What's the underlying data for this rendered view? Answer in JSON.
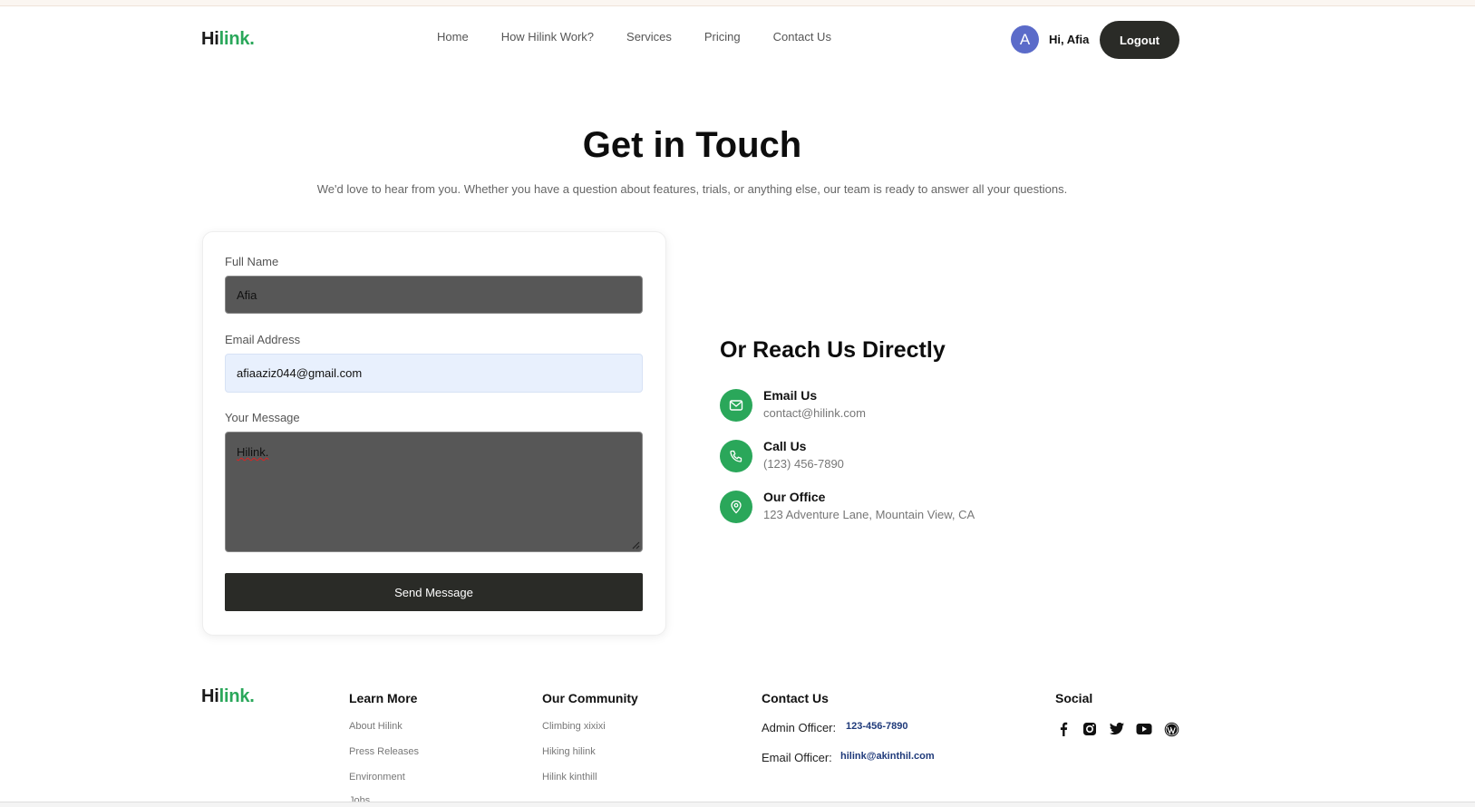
{
  "header": {
    "logo_dark": "Hi",
    "logo_green": "link.",
    "nav": [
      "Home",
      "How Hilink Work?",
      "Services",
      "Pricing",
      "Contact Us"
    ],
    "avatar_letter": "A",
    "greeting": "Hi, Afia",
    "logout_label": "Logout"
  },
  "hero": {
    "title": "Get in Touch",
    "subtitle": "We'd love to hear from you. Whether you have a question about features, trials, or anything else, our team is ready to answer all your questions."
  },
  "form": {
    "name_label": "Full Name",
    "name_value": "Afia",
    "email_label": "Email Address",
    "email_value": "afiaaziz044@gmail.com",
    "message_label": "Your Message",
    "message_value": "Hilink.",
    "submit_label": "Send Message"
  },
  "direct": {
    "heading": "Or Reach Us Directly",
    "items": [
      {
        "title": "Email Us",
        "text": "contact@hilink.com",
        "icon": "mail-icon"
      },
      {
        "title": "Call Us",
        "text": "(123) 456-7890",
        "icon": "phone-icon"
      },
      {
        "title": "Our Office",
        "text": "123 Adventure Lane, Mountain View, CA",
        "icon": "location-pin-icon"
      }
    ]
  },
  "footer": {
    "logo_dark": "Hi",
    "logo_green": "link.",
    "learn_more": {
      "heading": "Learn More",
      "links": [
        "About Hilink",
        "Press Releases",
        "Environment",
        "Jobs"
      ]
    },
    "community": {
      "heading": "Our Community",
      "links": [
        "Climbing xixixi",
        "Hiking hilink",
        "Hilink kinthill"
      ]
    },
    "contact": {
      "heading": "Contact Us",
      "admin_label": "Admin Officer:",
      "admin_value": "123-456-7890",
      "email_label": "Email Officer:",
      "email_value": "hilink@akinthil.com"
    },
    "social": {
      "heading": "Social",
      "icons": [
        "facebook-icon",
        "instagram-icon",
        "twitter-icon",
        "youtube-icon",
        "wordpress-icon"
      ]
    }
  },
  "colors": {
    "accent": "#2aa75a",
    "dark_button": "#2a2b27",
    "avatar": "#5b6bc9"
  }
}
